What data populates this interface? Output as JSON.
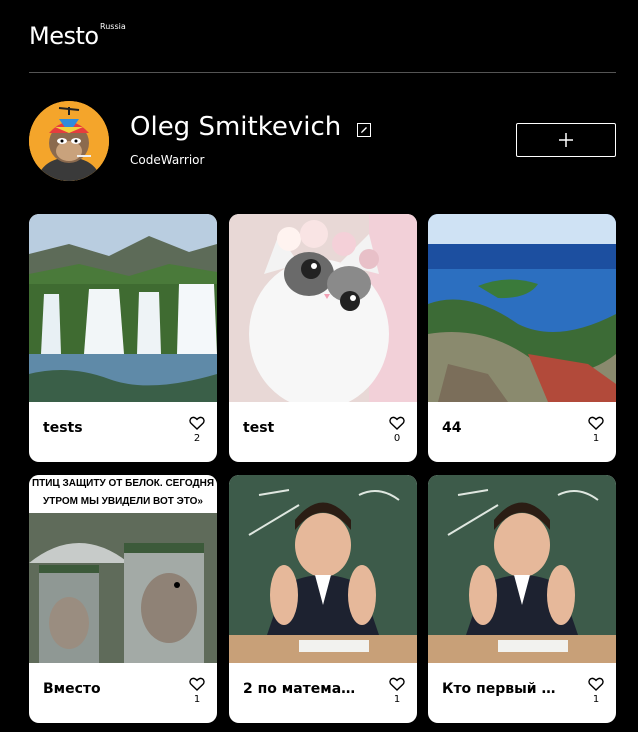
{
  "header": {
    "logo": "Mesto",
    "logo_sub": "Russia"
  },
  "profile": {
    "name": "Oleg Smitkevich",
    "about": "CodeWarrior"
  },
  "cards": [
    {
      "title": "tests",
      "likes": "2"
    },
    {
      "title": "test",
      "likes": "0"
    },
    {
      "title": "44",
      "likes": "1"
    },
    {
      "title": "Вместо",
      "likes": "1",
      "image_caption": "ПТИЦ ЗАЩИТУ ОТ БЕЛОК. СЕГОДНЯ УТРОМ МЫ УВИДЕЛИ ВОТ ЭТО»"
    },
    {
      "title": "2 по матема…",
      "likes": "1"
    },
    {
      "title": "Кто первый …",
      "likes": "1"
    }
  ]
}
